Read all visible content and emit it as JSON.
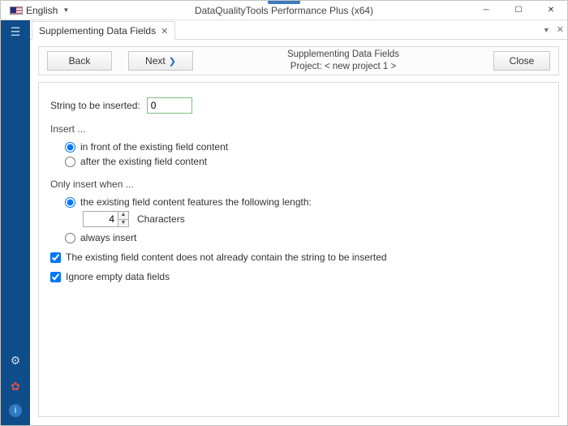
{
  "title": "DataQualityTools Performance Plus (x64)",
  "language": "English",
  "tab_label": "Supplementing Data Fields",
  "nav": {
    "back": "Back",
    "next": "Next",
    "close": "Close",
    "heading": "Supplementing Data Fields",
    "project": "Project: < new project 1 >"
  },
  "form": {
    "string_label": "String to be inserted:",
    "string_value": "0",
    "insert_heading": "Insert ...",
    "opt_infront": "in front of the existing field content",
    "opt_after": "after the existing field content",
    "only_heading": "Only insert when ...",
    "opt_length": "the existing field content features the following length:",
    "length_value": "4",
    "characters": "Characters",
    "opt_always": "always insert",
    "chk_notcontain": "The existing field content does not already contain the string to be inserted",
    "chk_ignoreempty": "Ignore empty data fields"
  }
}
